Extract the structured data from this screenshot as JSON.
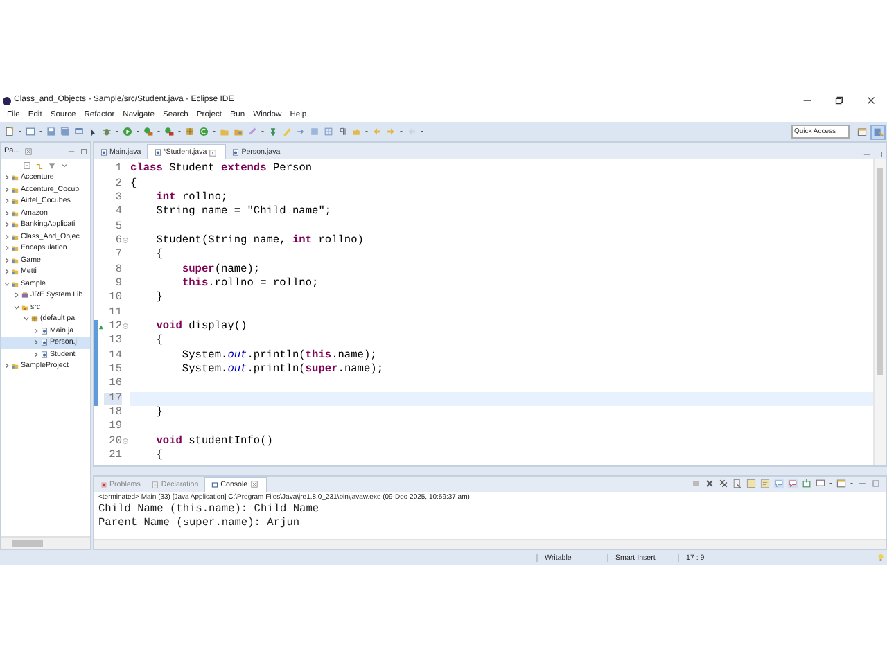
{
  "window": {
    "title": "Class_and_Objects - Sample/src/Student.java - Eclipse IDE"
  },
  "menu": [
    "File",
    "Edit",
    "Source",
    "Refactor",
    "Navigate",
    "Search",
    "Project",
    "Run",
    "Window",
    "Help"
  ],
  "quick_access": {
    "placeholder": "Quick Access"
  },
  "package_explorer": {
    "title": "Pa...",
    "items": [
      {
        "label": "Accenture",
        "kind": "project",
        "expanded": false,
        "selected": false
      },
      {
        "label": "Accenture_Cocub",
        "kind": "project",
        "expanded": false,
        "selected": false
      },
      {
        "label": "Airtel_Cocubes",
        "kind": "project",
        "expanded": false,
        "selected": false
      },
      {
        "label": "Amazon",
        "kind": "project",
        "expanded": false,
        "selected": false
      },
      {
        "label": "BankingApplicati",
        "kind": "project",
        "expanded": false,
        "selected": false
      },
      {
        "label": "Class_And_Objec",
        "kind": "project",
        "expanded": false,
        "selected": false
      },
      {
        "label": "Encapsulation",
        "kind": "project",
        "expanded": false,
        "selected": false
      },
      {
        "label": "Game",
        "kind": "project",
        "expanded": false,
        "selected": false
      },
      {
        "label": "Metti",
        "kind": "project",
        "expanded": false,
        "selected": false
      },
      {
        "label": "Sample",
        "kind": "project",
        "expanded": true,
        "selected": false,
        "children": [
          {
            "label": "JRE System Lib",
            "kind": "library",
            "expanded": false,
            "selected": false
          },
          {
            "label": "src",
            "kind": "source-folder",
            "expanded": true,
            "selected": false,
            "children": [
              {
                "label": "(default pa",
                "kind": "package",
                "expanded": true,
                "selected": false,
                "children": [
                  {
                    "label": "Main.ja",
                    "kind": "java-file",
                    "expanded": false,
                    "selected": false
                  },
                  {
                    "label": "Person.j",
                    "kind": "java-file",
                    "expanded": false,
                    "selected": true
                  },
                  {
                    "label": "Student",
                    "kind": "java-file",
                    "expanded": false,
                    "selected": false
                  }
                ]
              }
            ]
          }
        ]
      },
      {
        "label": "SampleProject",
        "kind": "project",
        "expanded": false,
        "selected": false
      }
    ]
  },
  "editor": {
    "tabs": [
      {
        "label": "Main.java",
        "selected": false
      },
      {
        "label": "*Student.java",
        "selected": true
      },
      {
        "label": "Person.java",
        "selected": false
      }
    ],
    "lines": [
      {
        "number": "1",
        "text": "**class** Student **extends** Person",
        "fold": false,
        "override": false,
        "changed": false,
        "current": false
      },
      {
        "number": "2",
        "text": "{",
        "fold": false,
        "override": false,
        "changed": false,
        "current": false
      },
      {
        "number": "3",
        "text": "    **int** rollno;",
        "fold": false,
        "override": false,
        "changed": false,
        "current": false
      },
      {
        "number": "4",
        "text": "    String name = \"Child name\";",
        "fold": false,
        "override": false,
        "changed": false,
        "current": false
      },
      {
        "number": "5",
        "fold": false,
        "override": false,
        "changed": false,
        "current": false
      },
      {
        "number": "6",
        "text": "    Student(String name, **int** rollno)",
        "fold": true,
        "override": false,
        "changed": false,
        "current": false
      },
      {
        "number": "7",
        "text": "    {",
        "fold": false,
        "override": false,
        "changed": false,
        "current": false
      },
      {
        "number": "8",
        "text": "        **super**(name);",
        "fold": false,
        "override": false,
        "changed": false,
        "current": false
      },
      {
        "number": "9",
        "text": "        **this**.rollno = rollno;",
        "fold": false,
        "override": false,
        "changed": false,
        "current": false
      },
      {
        "number": "10",
        "text": "    }",
        "fold": false,
        "override": false,
        "changed": false,
        "current": false
      },
      {
        "number": "11",
        "fold": false,
        "override": false,
        "changed": false,
        "current": false
      },
      {
        "number": "12",
        "text": "    **void** display()",
        "fold": true,
        "override": true,
        "changed": true,
        "current": false
      },
      {
        "number": "13",
        "text": "    {",
        "fold": false,
        "override": false,
        "changed": true,
        "current": false
      },
      {
        "number": "14",
        "text": "        System.*out*.println(**this**.name);",
        "fold": false,
        "override": false,
        "changed": true,
        "current": false
      },
      {
        "number": "15",
        "text": "        System.*out*.println(**super**.name);",
        "fold": false,
        "override": false,
        "changed": true,
        "current": false
      },
      {
        "number": "16",
        "fold": false,
        "override": false,
        "changed": true,
        "current": false
      },
      {
        "number": "17",
        "fold": false,
        "override": false,
        "changed": true,
        "current": true
      },
      {
        "number": "18",
        "text": "    }",
        "fold": false,
        "override": false,
        "changed": false,
        "current": false
      },
      {
        "number": "19",
        "fold": false,
        "override": false,
        "changed": false,
        "current": false
      },
      {
        "number": "20",
        "text": "    **void** studentInfo()",
        "fold": true,
        "override": false,
        "changed": false,
        "current": false
      },
      {
        "number": "21",
        "text": "    {",
        "fold": false,
        "override": false,
        "changed": false,
        "current": false
      }
    ]
  },
  "console": {
    "tabs": [
      {
        "label": "Problems",
        "selected": false
      },
      {
        "label": "Declaration",
        "selected": false
      },
      {
        "label": "Console",
        "selected": true
      }
    ],
    "header": "<terminated> Main (33) [Java Application] C:\\Program Files\\Java\\jre1.8.0_231\\bin\\javaw.exe (09-Dec-2025, 10:59:37 am)",
    "output": [
      "Child Name (this.name): Child Name",
      "Parent Name (super.name): Arjun"
    ]
  },
  "status_bar": {
    "mode": "Writable",
    "insert_mode": "Smart Insert",
    "position": "17 : 9"
  }
}
